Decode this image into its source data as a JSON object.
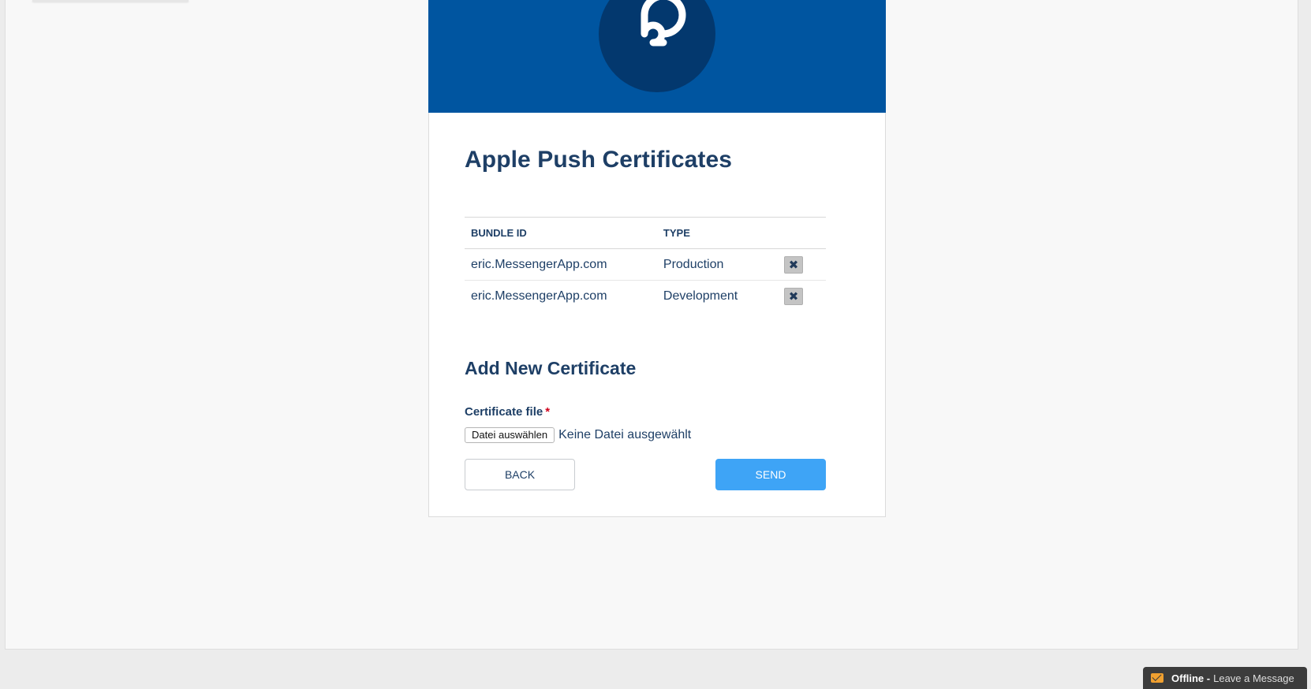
{
  "card": {
    "title": "Apple Push Certificates",
    "logo_icon": "parse-logo-icon"
  },
  "certificates": {
    "columns": [
      "BUNDLE ID",
      "TYPE"
    ],
    "rows": [
      {
        "bundle_id": "eric.MessengerApp.com",
        "type": "Production",
        "delete_icon": "✖"
      },
      {
        "bundle_id": "eric.MessengerApp.com",
        "type": "Development",
        "delete_icon": "✖"
      }
    ]
  },
  "add_certificate": {
    "section_title": "Add New Certificate",
    "field_label": "Certificate file",
    "required_mark": "*",
    "file_button_label": "Datei auswählen",
    "file_status": "Keine Datei ausgewählt"
  },
  "actions": {
    "back_label": "BACK",
    "send_label": "SEND"
  },
  "chat_widget": {
    "status": "Offline -",
    "message": "Leave a Message",
    "icon": "mail-icon"
  },
  "colors": {
    "header_blue": "#0055a0",
    "logo_circle": "#03386e",
    "text_navy": "#1e3f66",
    "send_blue": "#3ea4f6",
    "required_red": "#d0021b"
  }
}
